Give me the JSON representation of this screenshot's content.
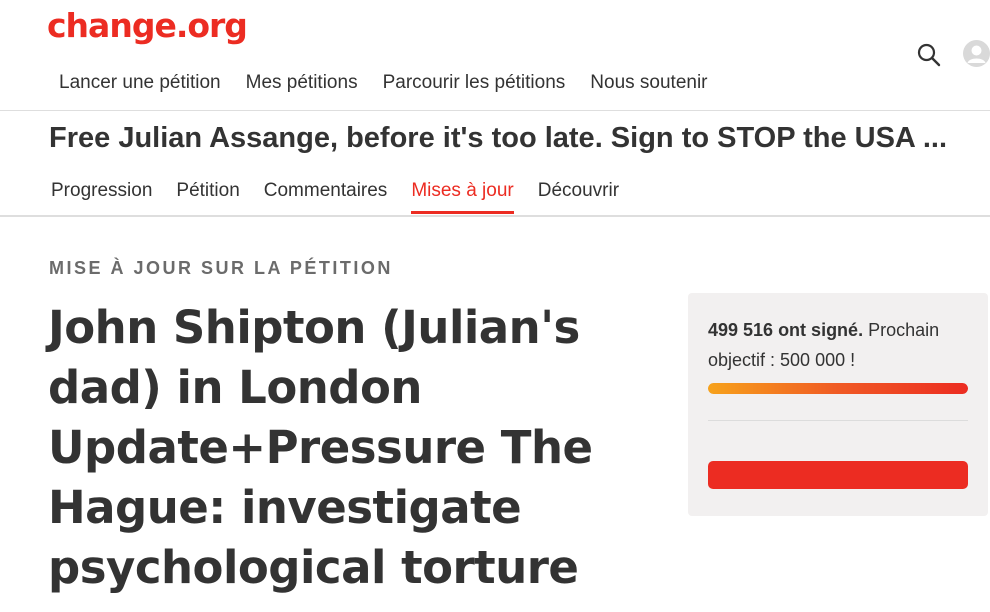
{
  "brand": {
    "logo": "change.org",
    "accent_color": "#ec2c22"
  },
  "topnav": {
    "items": [
      {
        "label": "Lancer une pétition"
      },
      {
        "label": "Mes pétitions"
      },
      {
        "label": "Parcourir les pétitions"
      },
      {
        "label": "Nous soutenir"
      }
    ],
    "search_icon": "search-icon",
    "avatar_icon": "user-avatar-icon"
  },
  "petition": {
    "title": "Free Julian Assange, before it's too late. Sign to STOP the USA ..."
  },
  "subnav": {
    "tabs": [
      {
        "label": "Progression",
        "active": false
      },
      {
        "label": "Pétition",
        "active": false
      },
      {
        "label": "Commentaires",
        "active": false
      },
      {
        "label": "Mises à jour",
        "active": true
      },
      {
        "label": "Découvrir",
        "active": false
      }
    ]
  },
  "update": {
    "eyebrow": "MISE À JOUR SUR LA PÉTITION",
    "title": "John Shipton (Julian's dad) in London Update+Pressure The Hague: investigate psychological torture"
  },
  "signatures": {
    "count_text": "499 516 ont signé.",
    "goal_text": "Prochain objectif : 500 000 !",
    "progress_fraction": 0.999
  }
}
